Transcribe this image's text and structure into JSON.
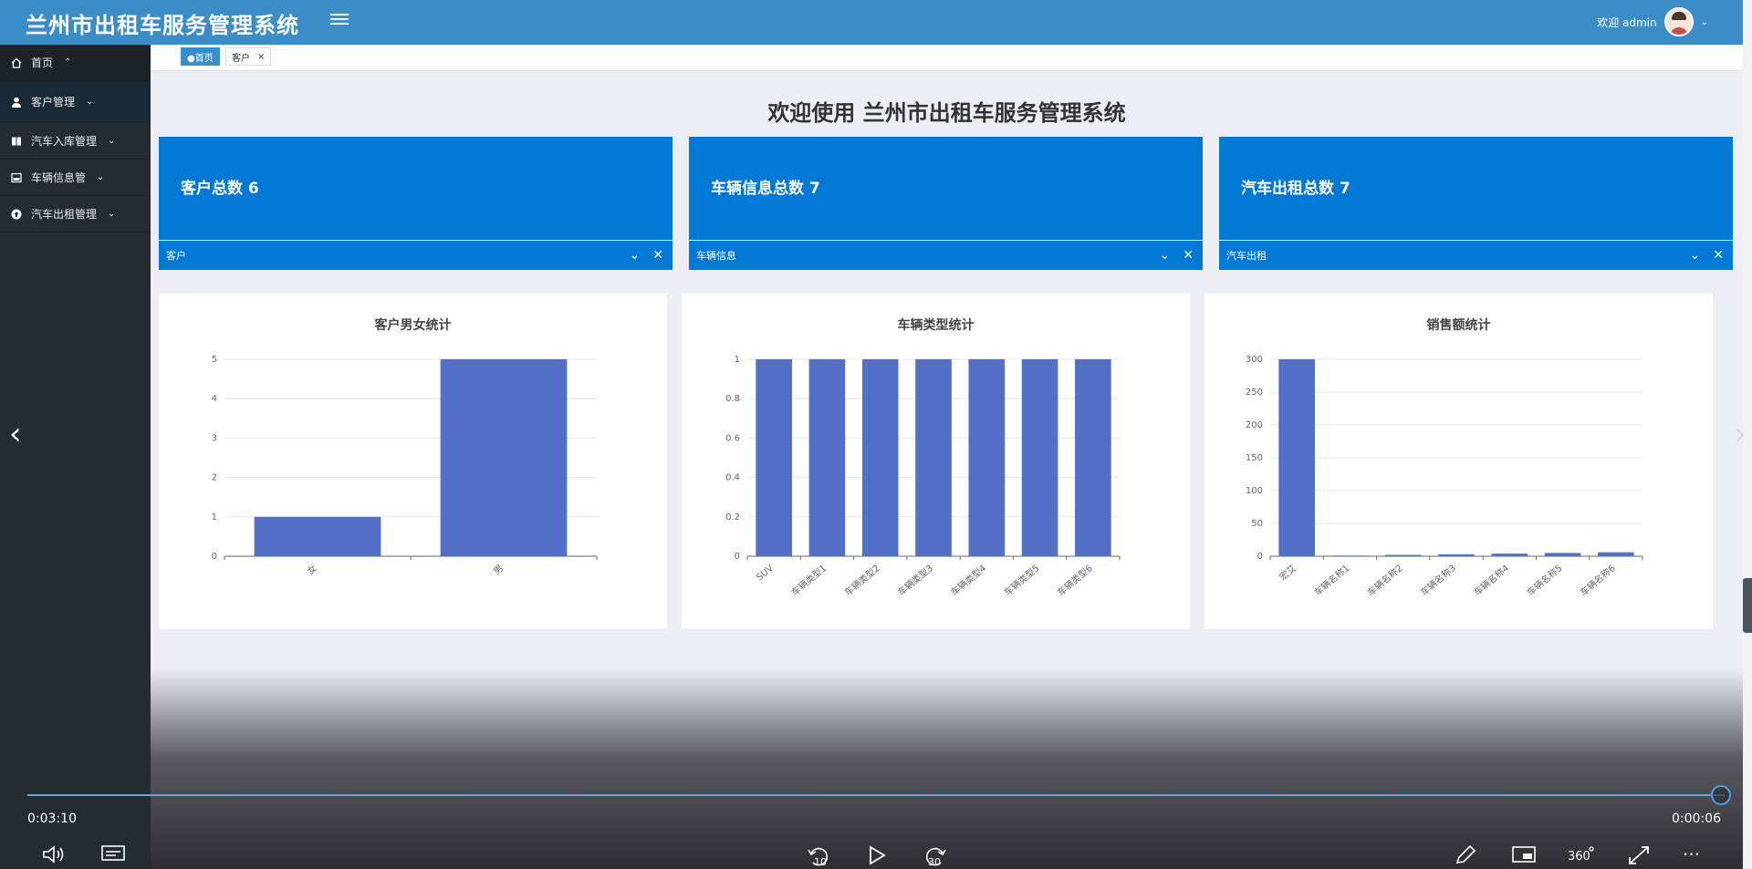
{
  "header": {
    "title": "兰州市出租车服务管理系统",
    "welcome_text": "欢迎 admin"
  },
  "sidebar": {
    "items": [
      {
        "label": "首页",
        "icon": "home-icon",
        "caret": "⌃"
      },
      {
        "label": "客户管理",
        "icon": "user-icon",
        "caret": "⌄"
      },
      {
        "label": "汽车入库管理",
        "icon": "book-icon",
        "caret": "⌄"
      },
      {
        "label": "车辆信息管",
        "icon": "image-icon",
        "caret": "⌄"
      },
      {
        "label": "汽车出租管理",
        "icon": "upload-circle-icon",
        "caret": "⌄"
      }
    ]
  },
  "tabs": [
    {
      "label": "●首页"
    },
    {
      "label": "客户",
      "close": "×"
    }
  ],
  "main": {
    "welcome_title": "欢迎使用 兰州市出租车服务管理系统"
  },
  "cards": [
    {
      "text": "客户总数  6",
      "footer": "客户"
    },
    {
      "text": "车辆信息总数  7",
      "footer": "车辆信息"
    },
    {
      "text": "汽车出租总数  7",
      "footer": "汽车出租"
    }
  ],
  "colors": {
    "header": "#3a8dc6",
    "sidebar": "#252b31",
    "card": "#0078d4",
    "bar": "#5470c6"
  },
  "chart_data": [
    {
      "type": "bar",
      "title": "客户男女统计",
      "categories": [
        "女",
        "男"
      ],
      "values": [
        1,
        5
      ],
      "ylim": [
        0,
        5
      ],
      "yticks": [
        "0",
        "1",
        "2",
        "3",
        "4",
        "5"
      ]
    },
    {
      "type": "bar",
      "title": "车辆类型统计",
      "categories": [
        "SUV",
        "车辆类型1",
        "车辆类型2",
        "车辆类型3",
        "车辆类型4",
        "车辆类型5",
        "车辆类型6"
      ],
      "values": [
        1,
        1,
        1,
        1,
        1,
        1,
        1
      ],
      "ylim": [
        0,
        1
      ],
      "yticks": [
        "0",
        "0.2",
        "0.4",
        "0.6",
        "0.8",
        "1"
      ]
    },
    {
      "type": "bar",
      "title": "销售额统计",
      "categories": [
        "宏艾",
        "车辆名称1",
        "车辆名称2",
        "车辆名称3",
        "车辆名称4",
        "车辆名称5",
        "车辆名称6"
      ],
      "values": [
        300,
        1,
        2,
        3,
        4,
        5,
        6
      ],
      "ylim": [
        0,
        300
      ],
      "yticks": [
        "0",
        "50",
        "100",
        "150",
        "200",
        "250",
        "300"
      ]
    }
  ],
  "video": {
    "elapsed": "0:03:10",
    "remaining": "0:00:06",
    "progress": 0.998,
    "rewind_label": "10",
    "forward_label": "30",
    "vr_label": "360"
  }
}
